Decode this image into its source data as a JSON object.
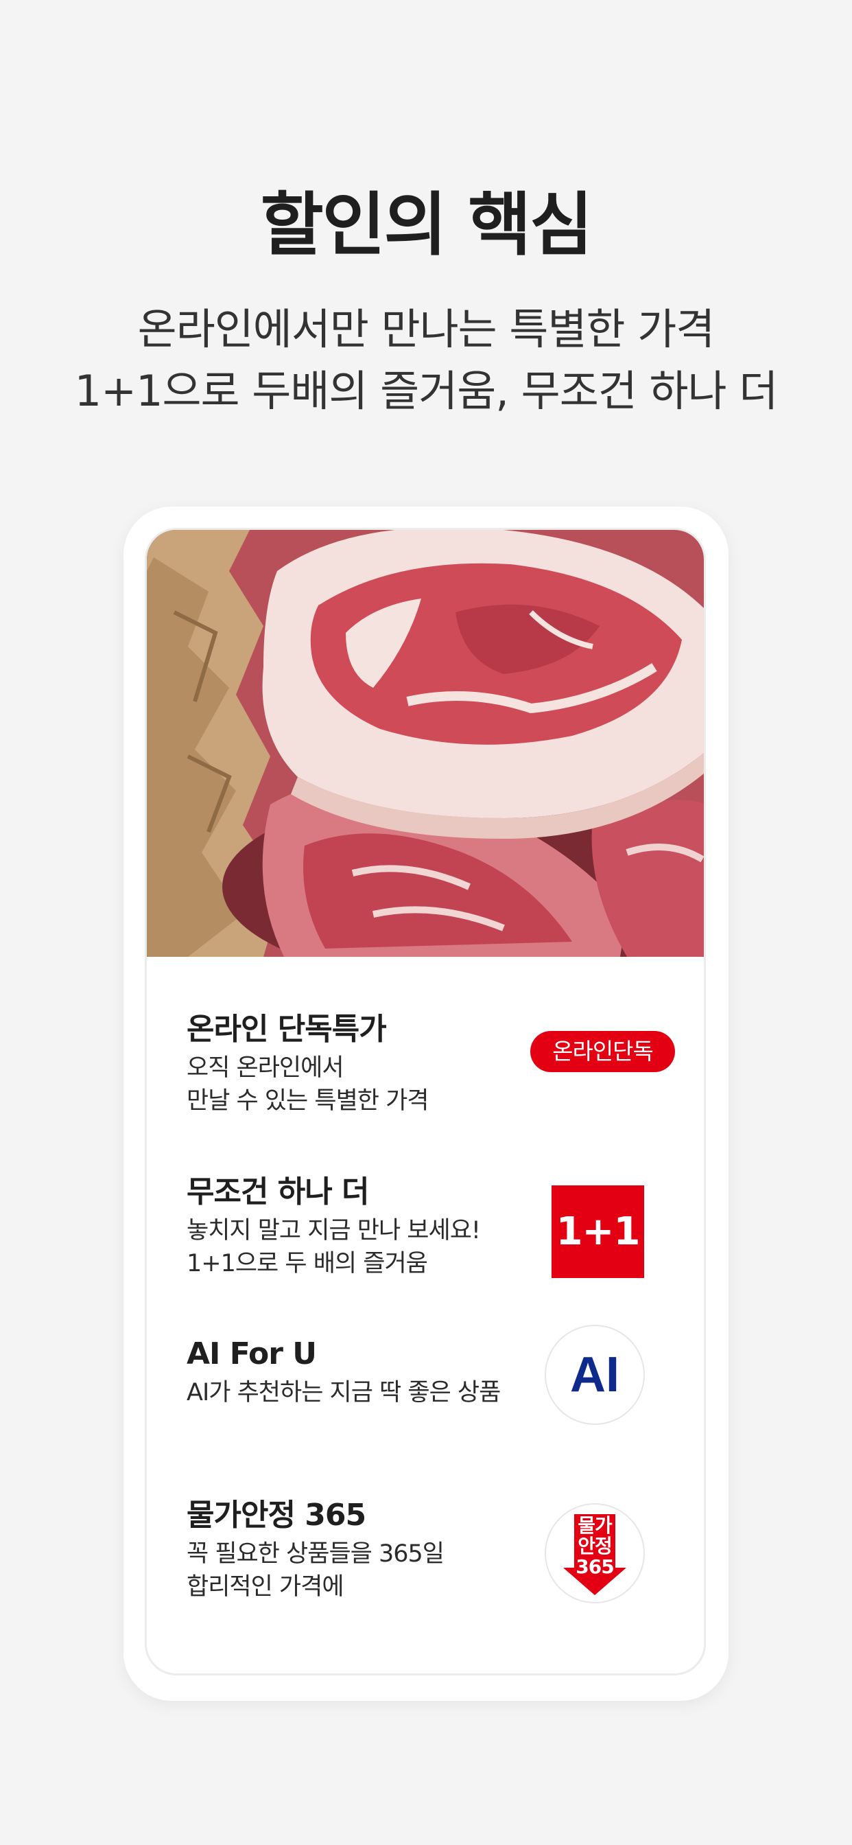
{
  "headline": "할인의 핵심",
  "subheadline": {
    "line1": "온라인에서만 만나는 특별한 가격",
    "line2": "1+1으로 두배의 즐거움, 무조건 하나 더"
  },
  "features": [
    {
      "title": "온라인 단독특가",
      "desc_line1": "오직 온라인에서",
      "desc_line2": "만날 수 있는 특별한 가격",
      "badge": "온라인단독"
    },
    {
      "title": "무조건 하나 더",
      "desc_line1": "놓치지 말고 지금 만나 보세요!",
      "desc_line2": "1+1으로 두 배의 즐거움",
      "badge": "1+1"
    },
    {
      "title": "AI For U",
      "desc_line1": "AI가 추천하는 지금 딱 좋은 상품",
      "badge": "AI"
    },
    {
      "title": "물가안정 365",
      "desc_line1": "꼭 필요한 상품들을 365일",
      "desc_line2": "합리적인 가격에",
      "badge_line1": "물가",
      "badge_line2": "안정",
      "badge_line3": "365"
    }
  ],
  "colors": {
    "accent_red": "#e30012",
    "ai_blue": "#0e2a8a",
    "background": "#f4f4f4"
  }
}
